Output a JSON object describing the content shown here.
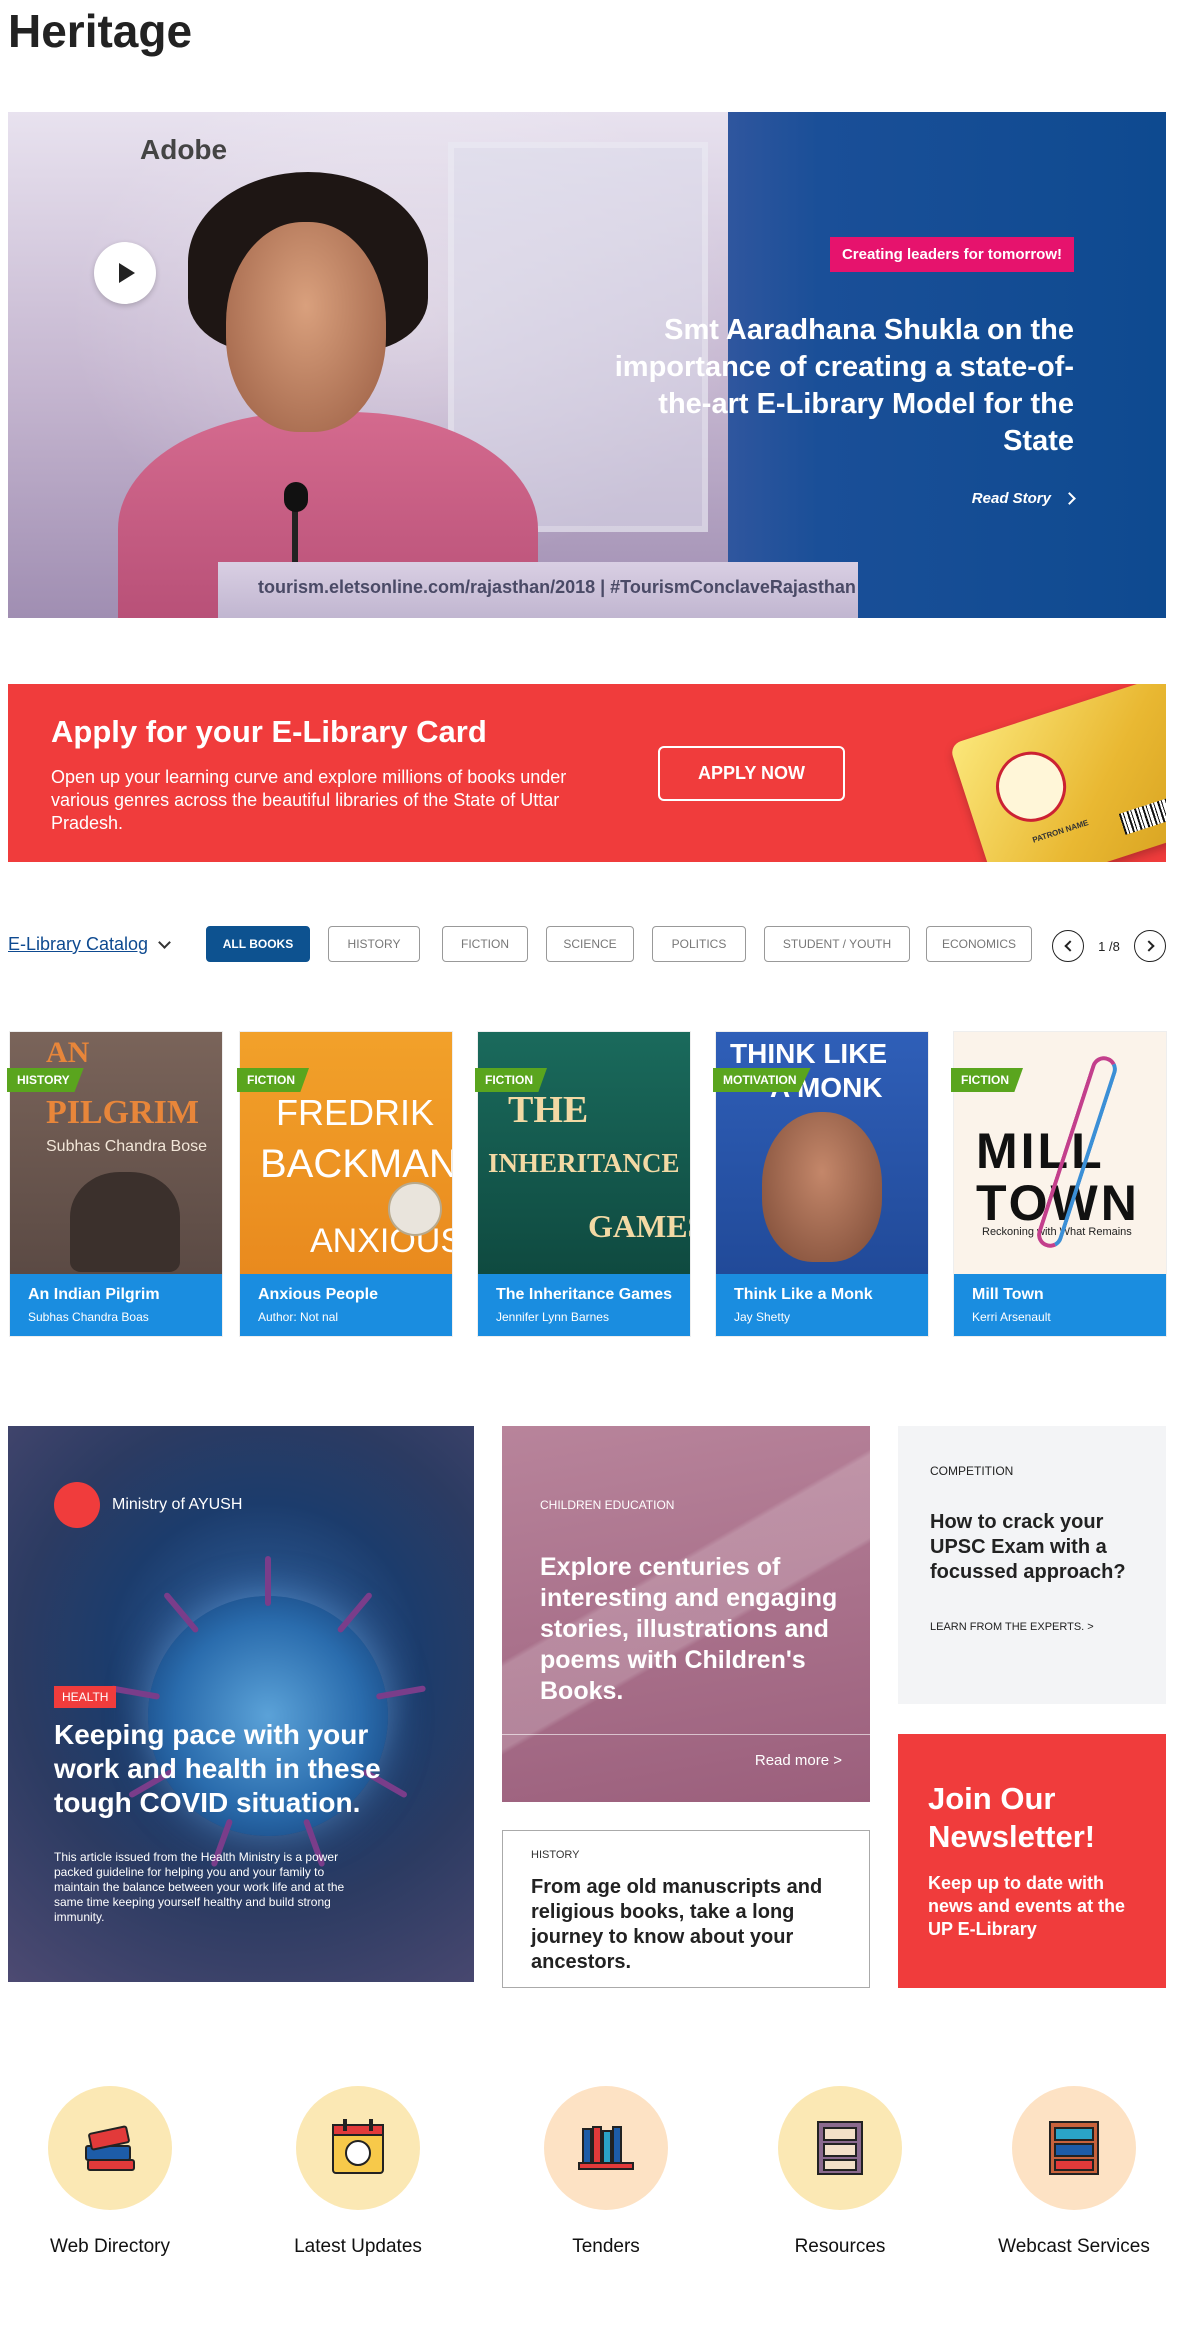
{
  "page": {
    "title": "Heritage"
  },
  "hero": {
    "logo_text": "Adobe",
    "podium_text": "tourism.eletsonline.com/rajasthan/2018  |  #TourismConclaveRajasthan",
    "tag": "Creating leaders for tomorrow!",
    "headline": "Smt Aaradhana Shukla on the importance of creating a state-of-the-art E-Library Model for the State",
    "read_label": "Read Story",
    "accent_color": "#e6136d"
  },
  "card_banner": {
    "title": "Apply for your E-Library Card",
    "description": "Open up your learning curve and explore millions of books under various genres across the beautiful libraries of the State of Uttar Pradesh.",
    "button_label": "APPLY NOW",
    "card_name_label": "PATRON NAME",
    "color": "#f03c3c"
  },
  "catalog": {
    "title": "E-Library Catalog",
    "filters": [
      "ALL BOOKS",
      "HISTORY",
      "FICTION",
      "SCIENCE",
      "POLITICS",
      "STUDENT / YOUTH",
      "ECONOMICS"
    ],
    "active_filter": "ALL BOOKS",
    "pager": "1 /8"
  },
  "books": [
    {
      "genre": "HISTORY",
      "title": "An Indian Pilgrim",
      "author": "Subhas Chandra Boas",
      "cover_line1": "AN",
      "cover_line2": "PILGRIM",
      "cover_line3": "Subhas Chandra Bose"
    },
    {
      "genre": "FICTION",
      "title": "Anxious People",
      "author": "Author: Not nal",
      "cover_line1": "FREDRIK",
      "cover_line2": "BACKMAN",
      "cover_line3": "ANXIOUS"
    },
    {
      "genre": "FICTION",
      "title": "The Inheritance Games",
      "author": "Jennifer Lynn Barnes",
      "cover_line1": "THE",
      "cover_line2": "INHERITANCE",
      "cover_line3": "GAMES"
    },
    {
      "genre": "MOTIVATION",
      "title": "Think Like a Monk",
      "author": "Jay Shetty",
      "cover_line1": "THINK LIKE",
      "cover_line2": "A MONK",
      "cover_line3": ""
    },
    {
      "genre": "FICTION",
      "title": "Mill Town",
      "author": "Kerri Arsenault",
      "cover_line1": "MILL",
      "cover_line2": "TOWN",
      "cover_line3": "Reckoning with What Remains"
    }
  ],
  "articles": {
    "covid": {
      "ministry": "Ministry of AYUSH",
      "tag": "HEALTH",
      "title": "Keeping pace with your work and health in these tough COVID situation.",
      "body": "This article issued from the Health Ministry is a power packed guideline for helping you and your family to maintain the balance between your work life and at the same time keeping yourself healthy and build strong immunity."
    },
    "children": {
      "tag": "CHILDREN EDUCATION",
      "title": "Explore centuries of interesting and engaging stories, illustrations and poems with Children's Books.",
      "more": "Read more >"
    },
    "history": {
      "tag": "HISTORY",
      "title": "From age old manuscripts and religious books, take a long journey to know about your ancestors."
    },
    "competition": {
      "tag": "COMPETITION",
      "title": "How to crack your UPSC Exam with a focussed approach?",
      "link": "LEARN FROM THE EXPERTS.  >"
    },
    "newsletter": {
      "title": "Join Our Newsletter!",
      "body": "Keep up to date with news and events at the UP E-Library"
    }
  },
  "services": [
    {
      "label": "Web Directory",
      "icon": "books-icon"
    },
    {
      "label": "Latest Updates",
      "icon": "calendar-day-icon"
    },
    {
      "label": "Tenders",
      "icon": "bookshelf-icon"
    },
    {
      "label": "Resources",
      "icon": "cabinet-icon"
    },
    {
      "label": "Webcast Services",
      "icon": "library-shelf-icon"
    }
  ]
}
